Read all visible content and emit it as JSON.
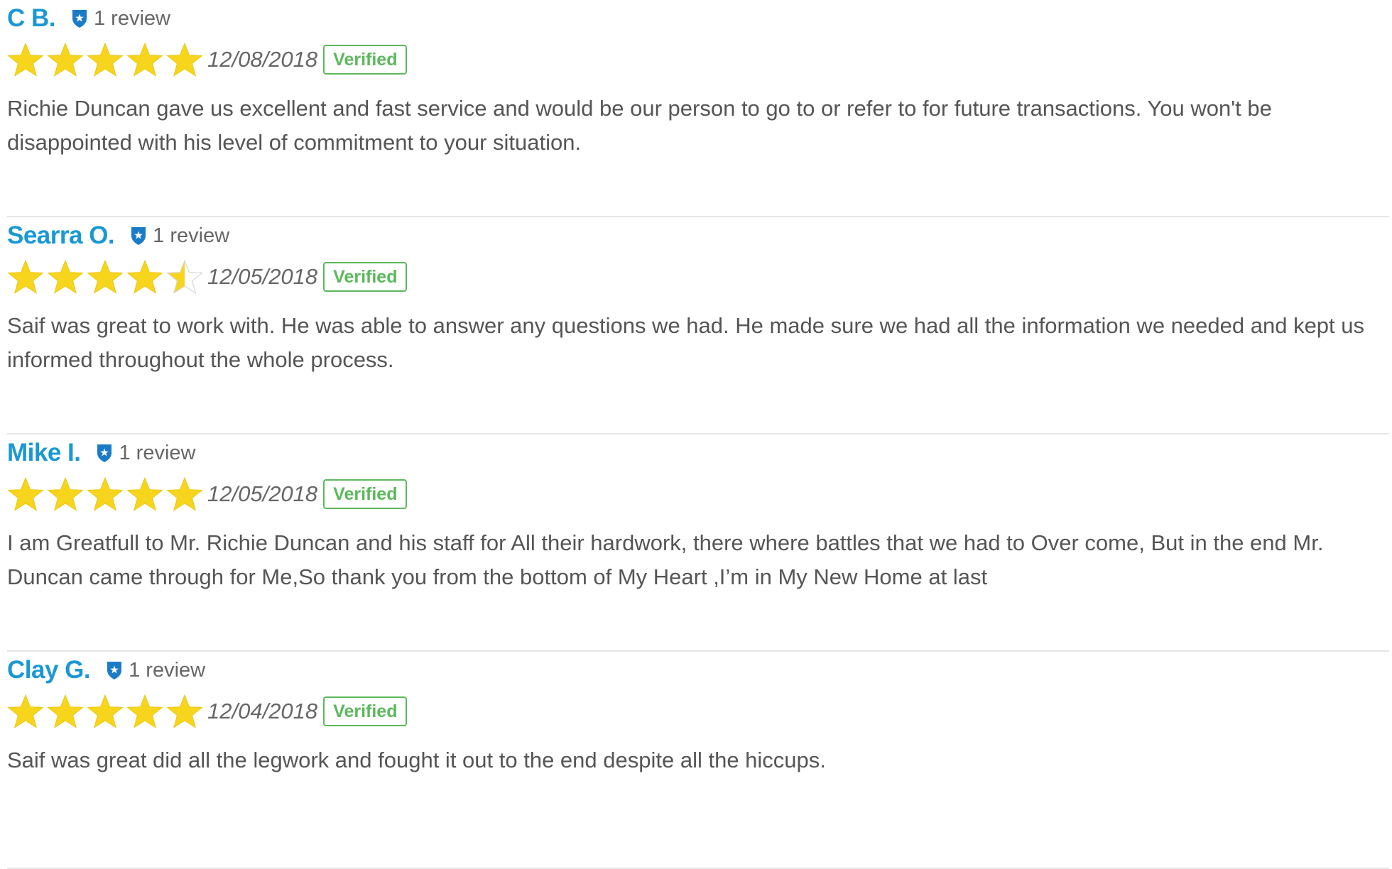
{
  "colors": {
    "name": "#1a98d5",
    "shield": "#1a7bc9",
    "star_filled": "#f7d51d",
    "star_empty": "#d9d9d9",
    "verified": "#5cb85c",
    "divider": "#e6e6e6",
    "text": "#555555"
  },
  "reviews": [
    {
      "name": "C B.",
      "review_count": "1 review",
      "rating": 5,
      "date": "12/08/2018",
      "verified": "Verified",
      "body": "Richie Duncan gave us excellent and fast service and would be our person to go to or refer to for future transactions. You won't be disappointed with his level of commitment to your situation."
    },
    {
      "name": "Searra O.",
      "review_count": "1 review",
      "rating": 4.5,
      "date": "12/05/2018",
      "verified": "Verified",
      "body": "Saif was great to work with. He was able to answer any questions we had. He made sure we had all the information we needed and kept us informed throughout the whole process."
    },
    {
      "name": "Mike I.",
      "review_count": "1 review",
      "rating": 5,
      "date": "12/05/2018",
      "verified": "Verified",
      "body": "I am Greatfull to Mr. Richie Duncan and his staff for All their hardwork, there where battles that we had to Over come, But in the end Mr. Duncan came through for Me,So thank you from the bottom of My Heart ,I’m in My New Home at last"
    },
    {
      "name": "Clay G.",
      "review_count": "1 review",
      "rating": 5,
      "date": "12/04/2018",
      "verified": "Verified",
      "body": "Saif was great did all the legwork and fought it out to the end despite all the hiccups."
    }
  ]
}
